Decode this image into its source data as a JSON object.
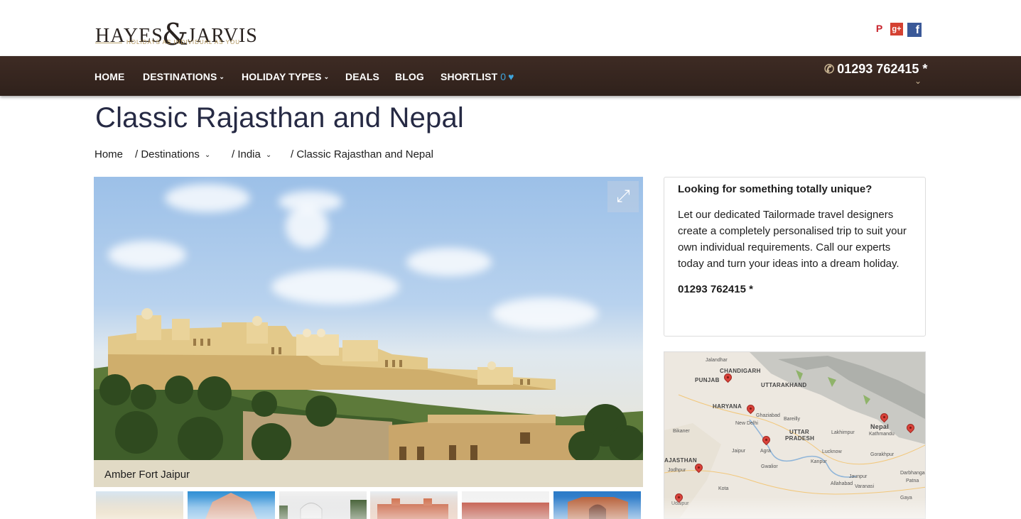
{
  "header": {
    "logo_text_left": "HAYES",
    "logo_amp": "&",
    "logo_text_right": "JARVIS",
    "logo_tagline": "HOLIDAYS AS INDIVIDUAL AS YOU",
    "social": {
      "pinterest": "P",
      "googleplus": "g+",
      "facebook": "f"
    }
  },
  "nav": {
    "items": [
      {
        "label": "HOME",
        "chev": ""
      },
      {
        "label": "DESTINATIONS",
        "chev": "⌄"
      },
      {
        "label": "HOLIDAY TYPES",
        "chev": "⌄"
      },
      {
        "label": "DEALS",
        "chev": ""
      },
      {
        "label": "BLOG",
        "chev": ""
      }
    ],
    "shortlist_label": "SHORTLIST",
    "shortlist_count": "0",
    "phone": "01293 762415 *"
  },
  "page": {
    "title": "Classic Rajasthan and Nepal",
    "breadcrumb": [
      "Home",
      "/ Destinations",
      "/ India",
      "/ Classic Rajasthan and Nepal"
    ]
  },
  "gallery": {
    "caption": "Amber Fort Jaipur"
  },
  "card": {
    "title": "Looking for something totally unique?",
    "body": "Let our dedicated Tailormade travel designers create a completely personalised trip to suit your own individual requirements. Call our experts today and turn your ideas into a dream holiday.",
    "phone": "01293 762415 *"
  },
  "map": {
    "regions": [
      "CHANDIGARH",
      "PUNJAB",
      "UTTARAKHAND",
      "HARYANA",
      "UTTAR",
      "PRADESH",
      "Nepal",
      "AJASTHAN"
    ],
    "cities": [
      "Jalandhar",
      "New Delhi",
      "Ghaziabad",
      "Bareilly",
      "Bikaner",
      "Lakhimpur",
      "Kathmandu",
      "Jaipur",
      "Agra",
      "Lucknow",
      "Kanpur",
      "Gorakhpur",
      "Jodhpur",
      "Gwalior",
      "Jaunpur",
      "Darbhanga",
      "Patna",
      "Kota",
      "Allahabad",
      "Varanasi",
      "Gaya",
      "Udaipur"
    ]
  },
  "colors": {
    "nav_bg": "#3e2b24",
    "accent_blue": "#3ea4dc",
    "title": "#262a44",
    "caption_bg": "#e1dac5",
    "logo_gold": "#b09359"
  }
}
